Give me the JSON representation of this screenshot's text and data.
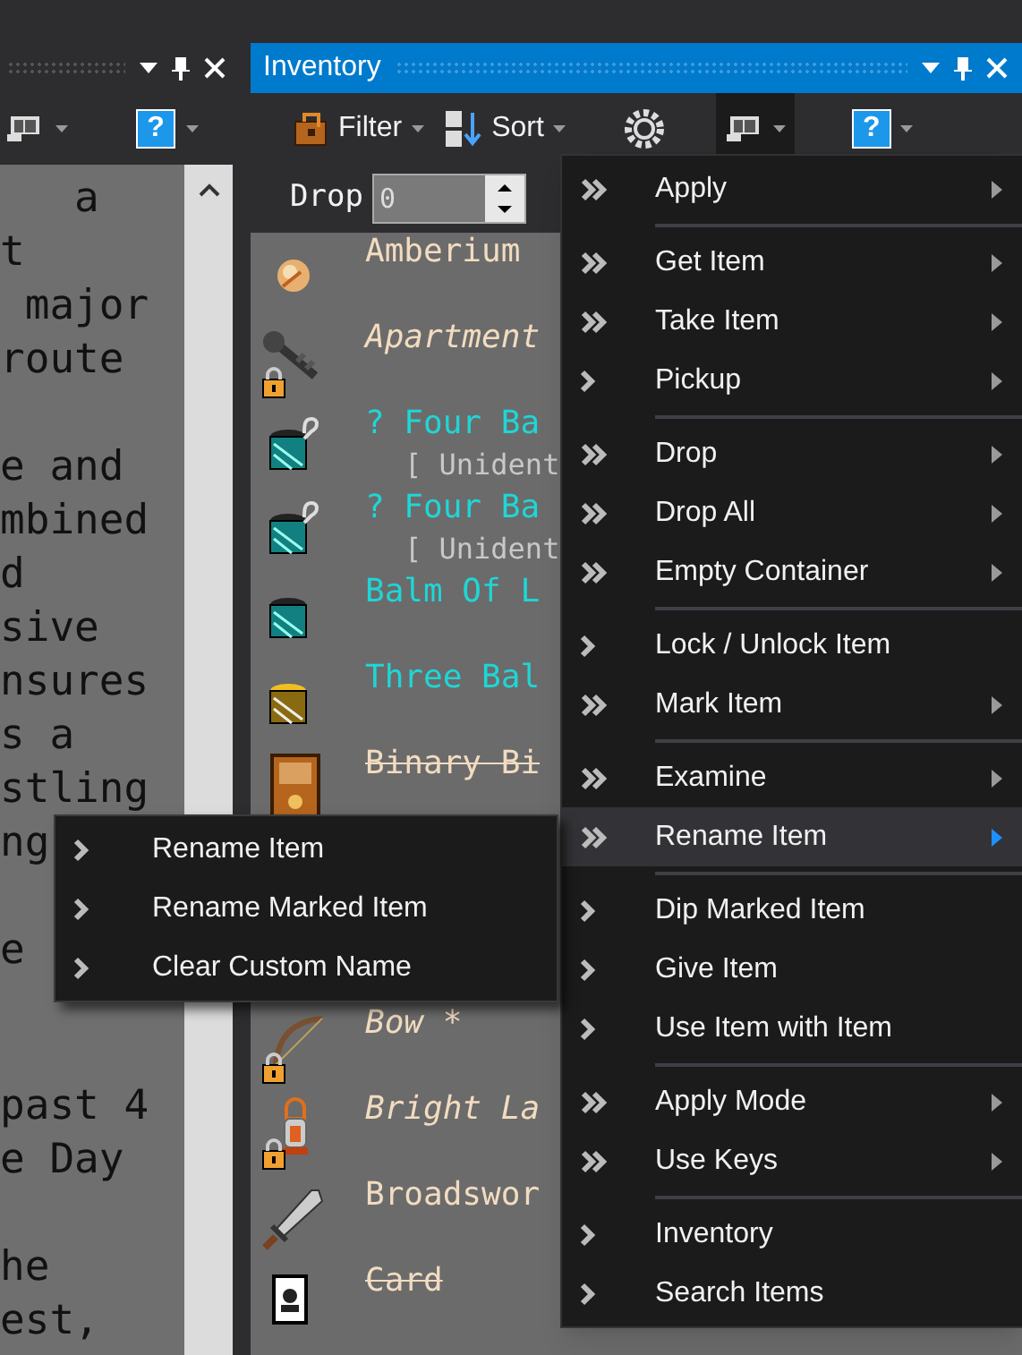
{
  "left_panel": {
    "toolbar": {
      "help_glyph": "?"
    },
    "text_top": [
      [
        "   a",
        "t",
        " major",
        "route"
      ],
      [
        "e and",
        "mbined",
        "d",
        "sive",
        "nsures",
        "s a",
        "stling",
        "ng"
      ],
      [
        "e"
      ]
    ],
    "text_bottom": [
      [
        "past 4",
        "e Day"
      ],
      [
        "he",
        "est,"
      ]
    ]
  },
  "inventory": {
    "title": "Inventory",
    "toolbar": {
      "filter": "Filter",
      "sort": "Sort",
      "view_open": true,
      "help_glyph": "?"
    },
    "drop": {
      "label": "Drop",
      "value": "0"
    },
    "items_top": [
      {
        "kind": "orb",
        "label": "Amberium",
        "crossed_out": false,
        "color": "#f2dcc0",
        "locked": false,
        "unidentified": false
      },
      {
        "kind": "key",
        "label": "Apartment",
        "crossed_out": false,
        "color": "#f2dcc0",
        "locked": true,
        "unidentified": false
      },
      {
        "kind": "jar",
        "label": "? Four Ba",
        "sub": "[ Unident",
        "crossed_out": false,
        "color": "#1fd6d6",
        "locked": false,
        "unidentified": true
      },
      {
        "kind": "jar",
        "label": "? Four Ba",
        "sub": "[ Unident",
        "crossed_out": false,
        "color": "#1fd6d6",
        "locked": false,
        "unidentified": true
      },
      {
        "kind": "jar",
        "label": "Balm Of L",
        "crossed_out": false,
        "color": "#1fd6d6",
        "locked": false,
        "unidentified": false
      },
      {
        "kind": "gold_jar",
        "label": "Three Bal",
        "crossed_out": false,
        "color": "#1fd6d6",
        "locked": false,
        "unidentified": false
      },
      {
        "kind": "book",
        "label": "Binary Bi",
        "crossed_out": true,
        "color": "#f2dcc0",
        "locked": false,
        "unidentified": false
      }
    ],
    "items_bottom": [
      {
        "kind": "bow",
        "label": "Bow *",
        "crossed_out": false,
        "color": "#f2dcc0",
        "locked": true,
        "unidentified": false
      },
      {
        "kind": "lantern",
        "label": "Bright La",
        "crossed_out": false,
        "color": "#f2dcc0",
        "locked": true,
        "unidentified": false
      },
      {
        "kind": "sword",
        "label": "Broadswor",
        "crossed_out": false,
        "color": "#f2dcc0",
        "locked": false,
        "unidentified": false
      },
      {
        "kind": "card",
        "label": "Card",
        "crossed_out": true,
        "color": "#f2dcc0",
        "locked": false,
        "unidentified": false
      }
    ]
  },
  "context_menu": {
    "groups": [
      [
        {
          "label": "Apply",
          "kind": "double",
          "has_submenu": true,
          "selected": false
        }
      ],
      [
        {
          "label": "Get Item",
          "kind": "double",
          "has_submenu": true,
          "selected": false
        },
        {
          "label": "Take Item",
          "kind": "double",
          "has_submenu": true,
          "selected": false
        },
        {
          "label": "Pickup",
          "kind": "single",
          "has_submenu": true,
          "selected": false
        }
      ],
      [
        {
          "label": "Drop",
          "kind": "double",
          "has_submenu": true,
          "selected": false
        },
        {
          "label": "Drop All",
          "kind": "double",
          "has_submenu": true,
          "selected": false
        },
        {
          "label": "Empty Container",
          "kind": "double",
          "has_submenu": true,
          "selected": false
        }
      ],
      [
        {
          "label": "Lock / Unlock Item",
          "kind": "single",
          "has_submenu": false,
          "selected": false
        },
        {
          "label": "Mark Item",
          "kind": "double",
          "has_submenu": true,
          "selected": false
        }
      ],
      [
        {
          "label": "Examine",
          "kind": "double",
          "has_submenu": true,
          "selected": false
        },
        {
          "label": "Rename Item",
          "kind": "double",
          "has_submenu": true,
          "selected": true
        }
      ],
      [
        {
          "label": "Dip Marked Item",
          "kind": "single",
          "has_submenu": false,
          "selected": false
        },
        {
          "label": "Give Item",
          "kind": "single",
          "has_submenu": false,
          "selected": false
        },
        {
          "label": "Use Item with Item",
          "kind": "single",
          "has_submenu": false,
          "selected": false
        }
      ],
      [
        {
          "label": "Apply Mode",
          "kind": "double",
          "has_submenu": true,
          "selected": false
        },
        {
          "label": "Use Keys",
          "kind": "double",
          "has_submenu": true,
          "selected": false
        }
      ],
      [
        {
          "label": "Inventory",
          "kind": "single",
          "has_submenu": false,
          "selected": false
        },
        {
          "label": "Search Items",
          "kind": "single",
          "has_submenu": false,
          "selected": false
        }
      ]
    ]
  },
  "submenu": {
    "items": [
      {
        "label": "Rename Item",
        "kind": "single"
      },
      {
        "label": "Rename Marked Item",
        "kind": "single"
      },
      {
        "label": "Clear Custom Name",
        "kind": "single"
      }
    ]
  }
}
